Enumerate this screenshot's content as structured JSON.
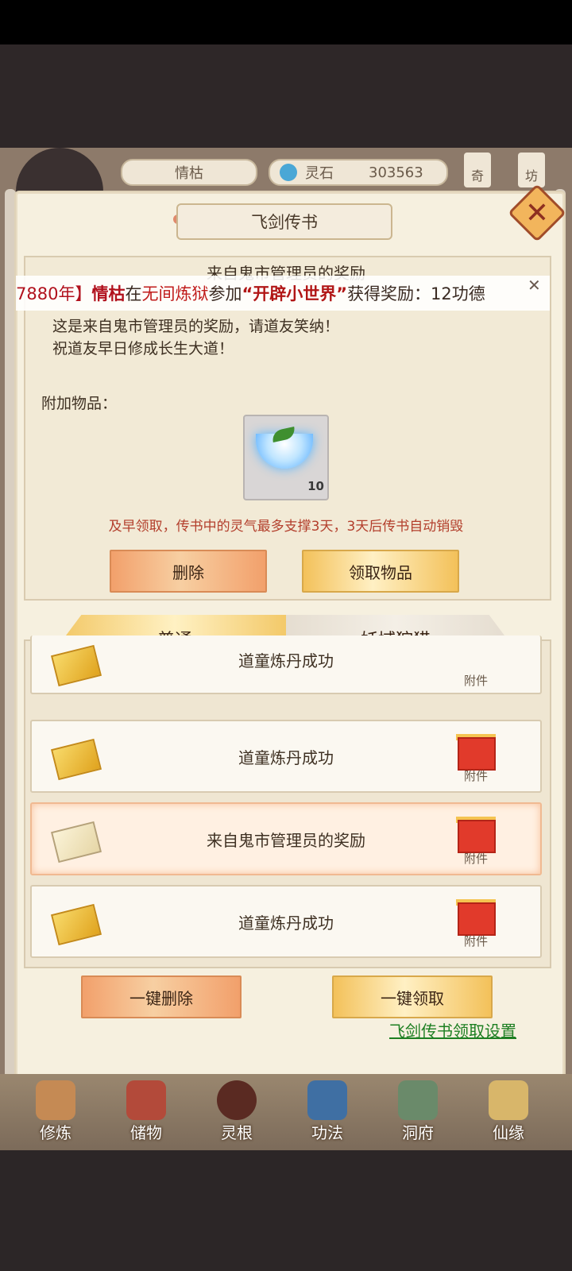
{
  "hud": {
    "player_name": "情枯",
    "currency_label": "灵石",
    "currency_value": "303563",
    "right_tab_1": "奇",
    "right_tab_2": "坊"
  },
  "dialog": {
    "title": "飞剑传书",
    "close_icon": "close-icon",
    "mail_subject": "来自鬼市管理员的奖励",
    "ticker": {
      "prefix": "7880年】",
      "name": "情枯",
      "mid1": "在",
      "place": "无间炼狱",
      "mid2": "参加",
      "event": "“开辟小世界”",
      "suffix": "获得奖励：12功德"
    },
    "body_lines": [
      "这是来自鬼市管理员的奖励，请道友笑纳！",
      "祝道友早日修成长生大道！"
    ],
    "attachment_label": "附加物品：",
    "item": {
      "icon": "spirit-tea-bowl-icon",
      "count": "10"
    },
    "warning": "及早领取，传书中的灵气最多支撑3天，3天后传书自动销毁",
    "delete_button": "删除",
    "claim_button": "领取物品"
  },
  "tabs": [
    {
      "label": "普通",
      "active": true
    },
    {
      "label": "妖域狩猎",
      "active": false
    }
  ],
  "mail_list": [
    {
      "title": "道童炼丹成功",
      "attach_label": "附件",
      "opened": false,
      "selected": false
    },
    {
      "title": "道童炼丹成功",
      "attach_label": "附件",
      "opened": false,
      "selected": false
    },
    {
      "title": "来自鬼市管理员的奖励",
      "attach_label": "附件",
      "opened": true,
      "selected": true
    },
    {
      "title": "道童炼丹成功",
      "attach_label": "附件",
      "opened": false,
      "selected": false
    }
  ],
  "footer": {
    "delete_all_button": "一键删除",
    "claim_all_button": "一键领取",
    "settings_link": "飞剑传书领取设置"
  },
  "bottom_nav": [
    {
      "label": "修炼",
      "icon": "cultivation-icon"
    },
    {
      "label": "储物",
      "icon": "storage-bag-icon"
    },
    {
      "label": "灵根",
      "icon": "spirit-root-icon"
    },
    {
      "label": "功法",
      "icon": "technique-book-icon"
    },
    {
      "label": "洞府",
      "icon": "cave-mansion-icon"
    },
    {
      "label": "仙缘",
      "icon": "immortal-fate-icon"
    }
  ]
}
